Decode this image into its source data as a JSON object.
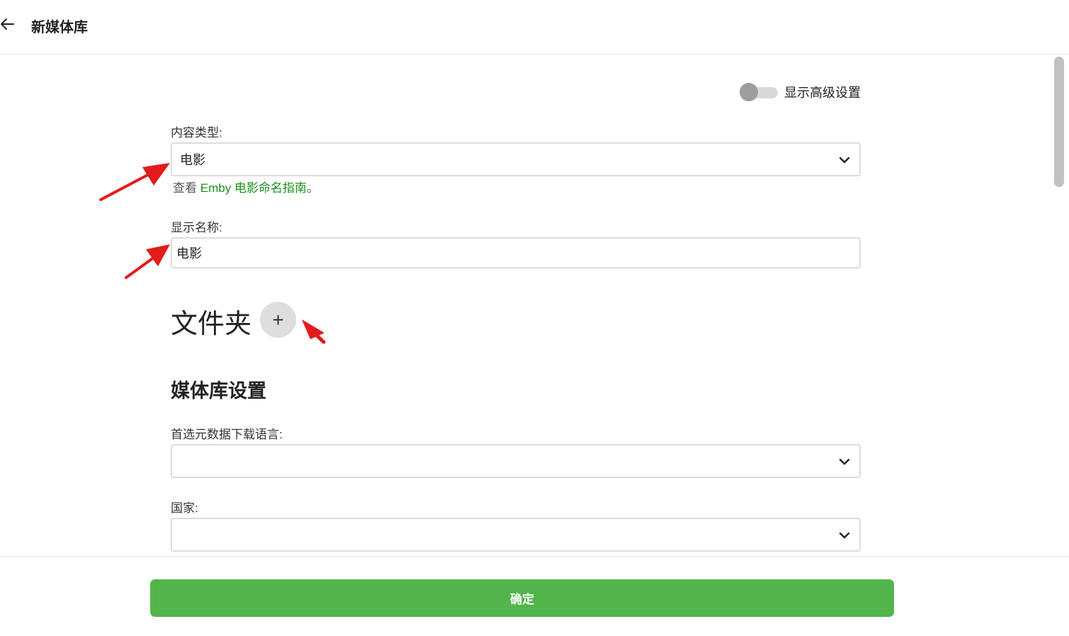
{
  "header": {
    "title": "新媒体库",
    "back_icon": "arrow-left-icon"
  },
  "advanced_toggle": {
    "label": "显示高级设置",
    "checked": false
  },
  "content_type": {
    "label": "内容类型:",
    "value": "电影"
  },
  "help": {
    "prefix": "查看 ",
    "link_text": "Emby 电影命名指南",
    "suffix": "。"
  },
  "display_name": {
    "label": "显示名称:",
    "value": "电影"
  },
  "folders": {
    "heading": "文件夹",
    "add_symbol": "+"
  },
  "library_settings": {
    "title": "媒体库设置"
  },
  "metadata_language": {
    "label": "首选元数据下载语言:",
    "value": ""
  },
  "country": {
    "label": "国家:",
    "value": ""
  },
  "footer": {
    "confirm_label": "确定"
  },
  "colors": {
    "accent": "#52b54b",
    "link": "#1a8f1a",
    "annotation": "#e51a1a"
  }
}
